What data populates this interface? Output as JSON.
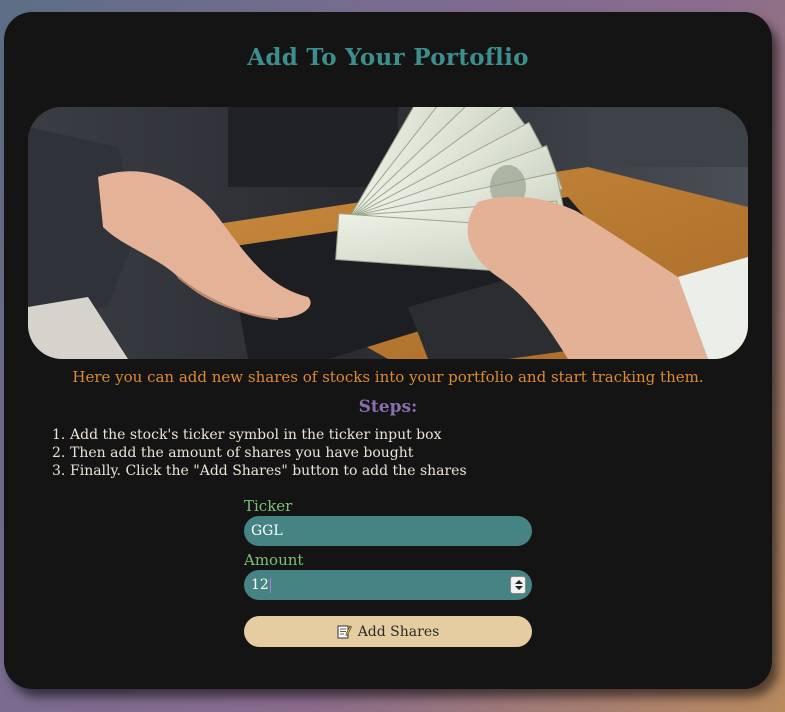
{
  "page": {
    "title": "Add To Your Portoflio",
    "intro": "Here you can add new shares of stocks into your portfolio and start tracking them.",
    "steps_title": "Steps:",
    "steps": [
      {
        "num": "1.",
        "text": "Add the stock's ticker symbol in the ticker input box"
      },
      {
        "num": "2.",
        "text": "Then add the amount of shares you have bought"
      },
      {
        "num": "3.",
        "text": "Finally. Click the \"Add Shares\" button to add the shares"
      }
    ]
  },
  "form": {
    "ticker_label": "Ticker",
    "ticker_value": "GGL",
    "amount_label": "Amount",
    "amount_value": "12",
    "submit_label": "Add Shares",
    "submit_icon": "memo-pencil-icon"
  },
  "colors": {
    "card_bg": "#141414",
    "title": "#3f8e8e",
    "intro": "#dd8a34",
    "steps_title": "#8a6fae",
    "label": "#7cc17a",
    "input_bg": "#468383",
    "button_bg": "#e5cda1"
  }
}
